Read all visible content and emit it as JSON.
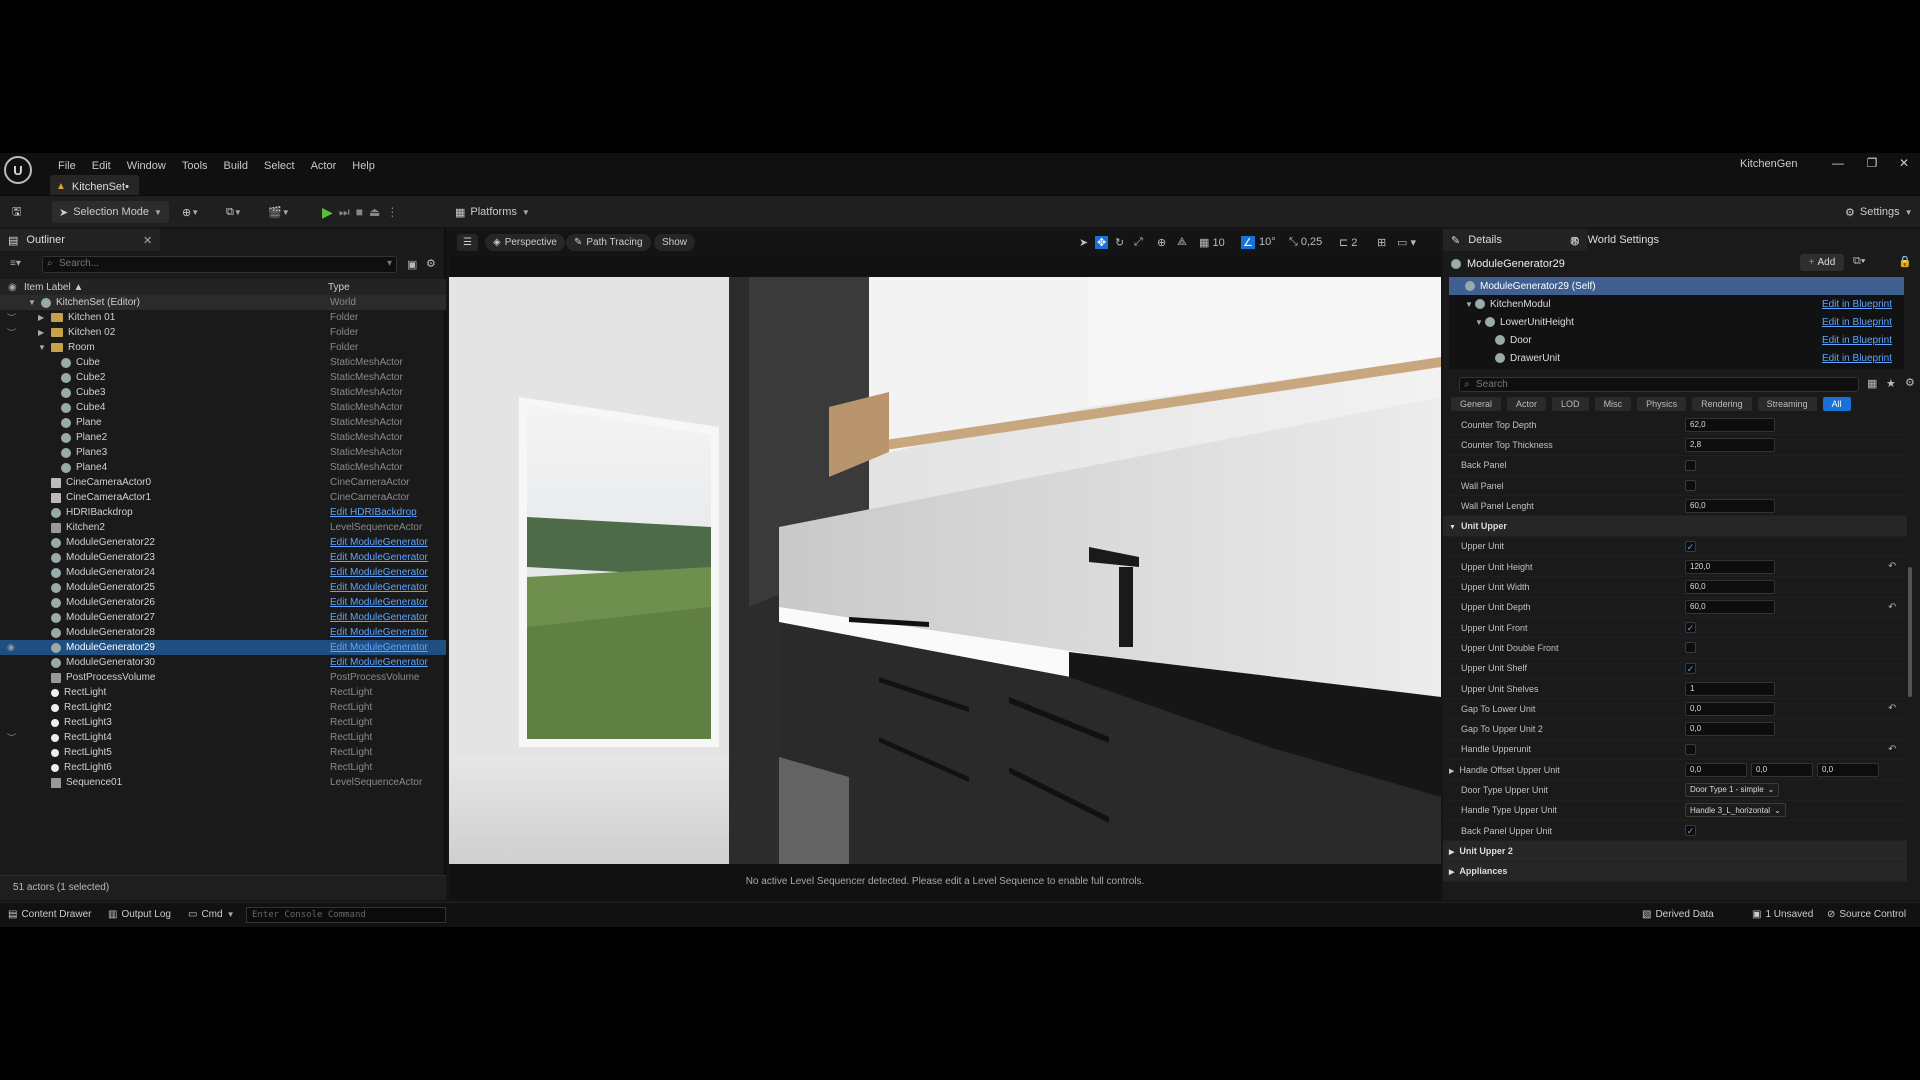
{
  "title_bar": {
    "menu": [
      "File",
      "Edit",
      "Window",
      "Tools",
      "Build",
      "Select",
      "Actor",
      "Help"
    ],
    "document_tab": "KitchenSet•",
    "project_name": "KitchenGen"
  },
  "toolbar": {
    "selection_mode": "Selection Mode",
    "platforms": "Platforms",
    "settings": "Settings"
  },
  "outliner": {
    "tab_label": "Outliner",
    "search_placeholder": "Search...",
    "col_label": "Item Label ▲",
    "col_type": "Type",
    "rows": [
      {
        "label": "KitchenSet (Editor)",
        "type": "World",
        "indent": 0,
        "icon": "world",
        "arrow": "▼",
        "kind": "world"
      },
      {
        "label": "Kitchen 01",
        "type": "Folder",
        "indent": 1,
        "icon": "folder",
        "arrow": "▶",
        "eye": "︶"
      },
      {
        "label": "Kitchen 02",
        "type": "Folder",
        "indent": 1,
        "icon": "folder",
        "arrow": "▶",
        "eye": "︶"
      },
      {
        "label": "Room",
        "type": "Folder",
        "indent": 1,
        "icon": "folder",
        "arrow": "▼"
      },
      {
        "label": "Cube",
        "type": "StaticMeshActor",
        "indent": 2,
        "icon": "mesh"
      },
      {
        "label": "Cube2",
        "type": "StaticMeshActor",
        "indent": 2,
        "icon": "mesh"
      },
      {
        "label": "Cube3",
        "type": "StaticMeshActor",
        "indent": 2,
        "icon": "mesh"
      },
      {
        "label": "Cube4",
        "type": "StaticMeshActor",
        "indent": 2,
        "icon": "mesh"
      },
      {
        "label": "Plane",
        "type": "StaticMeshActor",
        "indent": 2,
        "icon": "mesh"
      },
      {
        "label": "Plane2",
        "type": "StaticMeshActor",
        "indent": 2,
        "icon": "mesh"
      },
      {
        "label": "Plane3",
        "type": "StaticMeshActor",
        "indent": 2,
        "icon": "mesh"
      },
      {
        "label": "Plane4",
        "type": "StaticMeshActor",
        "indent": 2,
        "icon": "mesh"
      },
      {
        "label": "CineCameraActor0",
        "type": "CineCameraActor",
        "indent": 1,
        "icon": "cam"
      },
      {
        "label": "CineCameraActor1",
        "type": "CineCameraActor",
        "indent": 1,
        "icon": "cam"
      },
      {
        "label": "HDRIBackdrop",
        "type": "Edit HDRIBackdrop",
        "indent": 1,
        "icon": "mesh",
        "link": true
      },
      {
        "label": "Kitchen2",
        "type": "LevelSequenceActor",
        "indent": 1,
        "icon": "seq"
      },
      {
        "label": "ModuleGenerator22",
        "type": "Edit ModuleGenerator",
        "indent": 1,
        "icon": "mesh",
        "link": true
      },
      {
        "label": "ModuleGenerator23",
        "type": "Edit ModuleGenerator",
        "indent": 1,
        "icon": "mesh",
        "link": true
      },
      {
        "label": "ModuleGenerator24",
        "type": "Edit ModuleGenerator",
        "indent": 1,
        "icon": "mesh",
        "link": true
      },
      {
        "label": "ModuleGenerator25",
        "type": "Edit ModuleGenerator",
        "indent": 1,
        "icon": "mesh",
        "link": true
      },
      {
        "label": "ModuleGenerator26",
        "type": "Edit ModuleGenerator",
        "indent": 1,
        "icon": "mesh",
        "link": true
      },
      {
        "label": "ModuleGenerator27",
        "type": "Edit ModuleGenerator",
        "indent": 1,
        "icon": "mesh",
        "link": true
      },
      {
        "label": "ModuleGenerator28",
        "type": "Edit ModuleGenerator",
        "indent": 1,
        "icon": "mesh",
        "link": true
      },
      {
        "label": "ModuleGenerator29",
        "type": "Edit ModuleGenerator",
        "indent": 1,
        "icon": "mesh",
        "link": true,
        "selected": true,
        "eye": "◉"
      },
      {
        "label": "ModuleGenerator30",
        "type": "Edit ModuleGenerator",
        "indent": 1,
        "icon": "mesh",
        "link": true
      },
      {
        "label": "PostProcessVolume",
        "type": "PostProcessVolume",
        "indent": 1,
        "icon": "seq"
      },
      {
        "label": "RectLight",
        "type": "RectLight",
        "indent": 1,
        "icon": "light"
      },
      {
        "label": "RectLight2",
        "type": "RectLight",
        "indent": 1,
        "icon": "light"
      },
      {
        "label": "RectLight3",
        "type": "RectLight",
        "indent": 1,
        "icon": "light"
      },
      {
        "label": "RectLight4",
        "type": "RectLight",
        "indent": 1,
        "icon": "light",
        "eye": "︶"
      },
      {
        "label": "RectLight5",
        "type": "RectLight",
        "indent": 1,
        "icon": "light"
      },
      {
        "label": "RectLight6",
        "type": "RectLight",
        "indent": 1,
        "icon": "light"
      },
      {
        "label": "Sequence01",
        "type": "LevelSequenceActor",
        "indent": 1,
        "icon": "seq"
      }
    ],
    "footer": "51 actors (1 selected)"
  },
  "viewport": {
    "perspective": "Perspective",
    "path_tracing": "Path Tracing",
    "show": "Show",
    "grid_snap": "10",
    "rot_snap": "10°",
    "scale_snap": "0,25",
    "cam_speed": "2",
    "message": "No active Level Sequencer detected. Please edit a Level Sequence to enable full controls."
  },
  "details": {
    "tab_details": "Details",
    "tab_world": "World Settings",
    "actor_name": "ModuleGenerator29",
    "add_label": "Add",
    "search_placeholder": "Search",
    "components": [
      {
        "label": "ModuleGenerator29 (Self)",
        "indent": 0,
        "selected": true,
        "bp": ""
      },
      {
        "label": "KitchenModul",
        "indent": 1,
        "bp": "Edit in Blueprint",
        "arrow": "▼"
      },
      {
        "label": "LowerUnitHeight",
        "indent": 2,
        "bp": "Edit in Blueprint",
        "arrow": "▼"
      },
      {
        "label": "Door",
        "indent": 3,
        "bp": "Edit in Blueprint"
      },
      {
        "label": "DrawerUnit",
        "indent": 3,
        "bp": "Edit in Blueprint"
      }
    ],
    "filters": [
      "General",
      "Actor",
      "LOD",
      "Misc",
      "Physics",
      "Rendering",
      "Streaming",
      "All"
    ],
    "properties": [
      {
        "label": "Counter Top Depth",
        "kind": "num",
        "value": "62,0"
      },
      {
        "label": "Counter Top Thickness",
        "kind": "num",
        "value": "2,8"
      },
      {
        "label": "Back Panel",
        "kind": "chk",
        "value": ""
      },
      {
        "label": "Wall Panel",
        "kind": "chk",
        "value": ""
      },
      {
        "label": "Wall Panel Lenght",
        "kind": "num",
        "value": "60,0"
      },
      {
        "label": "Unit Upper",
        "kind": "cat",
        "arrow": "▼"
      },
      {
        "label": "Upper Unit",
        "kind": "chk",
        "value": "✓"
      },
      {
        "label": "Upper Unit Height",
        "kind": "num",
        "value": "120,0",
        "reset": true
      },
      {
        "label": "Upper Unit Width",
        "kind": "num",
        "value": "60,0"
      },
      {
        "label": "Upper Unit Depth",
        "kind": "num",
        "value": "60,0",
        "reset": true
      },
      {
        "label": "Upper Unit Front",
        "kind": "chk",
        "value": "✓"
      },
      {
        "label": "Upper Unit Double Front",
        "kind": "chk",
        "value": ""
      },
      {
        "label": "Upper Unit Shelf",
        "kind": "chk",
        "value": "✓"
      },
      {
        "label": "Upper Unit Shelves",
        "kind": "num",
        "value": "1"
      },
      {
        "label": "Gap To Lower Unit",
        "kind": "num",
        "value": "0,0",
        "reset": true
      },
      {
        "label": "Gap To Upper Unit 2",
        "kind": "num",
        "value": "0,0"
      },
      {
        "label": "Handle Upperunit",
        "kind": "chk",
        "value": "",
        "reset": true
      },
      {
        "label": "Handle Offset Upper Unit",
        "kind": "vec",
        "values": [
          "0,0",
          "0,0",
          "0,0"
        ],
        "arrow": "▶"
      },
      {
        "label": "Door Type Upper Unit",
        "kind": "dd",
        "value": "Door Type 1 - simple"
      },
      {
        "label": "Handle Type Upper Unit",
        "kind": "dd",
        "value": "Handle 3_L_horizontal"
      },
      {
        "label": "Back Panel Upper Unit",
        "kind": "chk",
        "value": "✓"
      },
      {
        "label": "Unit Upper 2",
        "kind": "cat",
        "arrow": "▶"
      },
      {
        "label": "Appliances",
        "kind": "cat",
        "arrow": "▶"
      }
    ]
  },
  "statusbar": {
    "content_drawer": "Content Drawer",
    "output_log": "Output Log",
    "cmd": "Cmd",
    "console_placeholder": "Enter Console Command",
    "derived_data": "Derived Data",
    "unsaved": "1 Unsaved",
    "source_control": "Source Control"
  }
}
